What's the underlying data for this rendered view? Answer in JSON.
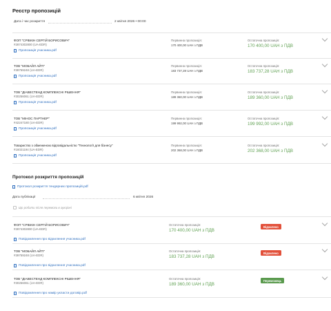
{
  "registry": {
    "title": "Реєстр пропозицій",
    "opening_label": "Дата і час розкриття",
    "opening_value": "2 квітня 2026 • 00:00",
    "initial_label": "Первинна пропозиція:",
    "final_label": "Остаточна пропозиція:",
    "offer_link": "Пропозиція учасника.pdf",
    "rows": [
      {
        "name": "ФОП \"СРІБКІН СЕРГІЙ БОРИСОВИЧ\"",
        "code": "#2874302800 (UA-EDR)",
        "initial": "170 400,00 UAH з ПДВ",
        "final": "170 400,00 UAH з ПДВ"
      },
      {
        "name": "ТОВ \"МОБАЙЛ АЙТІ\"",
        "code": "#39759248 (UA-EDR)",
        "initial": "183 737,28 UAH з ПДВ",
        "final": "183 737,28 UAH з ПДВ"
      },
      {
        "name": "ТОВ \"ДІАВЕСТЕНД КОМПЛЕКСНІ РІШЕННЯ\"",
        "code": "#30256061 (UA-EDR)",
        "initial": "189 360,00 UAH з ПДВ",
        "final": "189 360,00 UAH з ПДВ"
      },
      {
        "name": "ТОВ \"МІНОС ПАРТНЕР\"",
        "code": "#42247180 (UA-EDR)",
        "initial": "199 992,00 UAH з ПДВ",
        "final": "199 992,00 UAH з ПДВ"
      },
      {
        "name": "Товариство з обмеженою відповідальністю \"Технології для бізнесу\"",
        "code": "#16021194 (UA-EDR)",
        "initial": "202 368,00 UAH з ПДВ",
        "final": "202 368,00 UAH з ПДВ"
      }
    ]
  },
  "protocol": {
    "title": "Протокол розкриття пропозицій",
    "link": "Протокол розкриття тендерних пропозицій.pdf",
    "pub_label": "Дата публікації",
    "pub_value": "6 квітня 2026",
    "checkbox_text": "Що робити після перемоги в аукціоні",
    "final_label": "Остаточна пропозиція:",
    "rows": [
      {
        "name": "ФОП \"СРІБКІН СЕРГІЙ БОРИСОВИЧ\"",
        "code": "#2874302800 (UA-EDR)",
        "final": "170 400,00 UAH з ПДВ",
        "status": "Відхилено",
        "status_color": "#e2513b",
        "link": "Повідомлення про відхилення учасника.pdf"
      },
      {
        "name": "ТОВ \"МОБАЙЛ АЙТІ\"",
        "code": "#39759248 (UA-EDR)",
        "final": "183 737,28 UAH з ПДВ",
        "status": "Відхилено",
        "status_color": "#e2513b",
        "link": "Повідомлення про відхилення учасника.pdf"
      },
      {
        "name": "ТОВ \"ДІАВЕСТЕНД КОМПЛЕКСНІ РІШЕННЯ\"",
        "code": "#30256061 (UA-EDR)",
        "final": "189 360,00 UAH з ПДВ",
        "status": "Переможець",
        "status_color": "#5a9a4e",
        "link": "Повідомлення про намір укласти договір.pdf"
      }
    ]
  }
}
